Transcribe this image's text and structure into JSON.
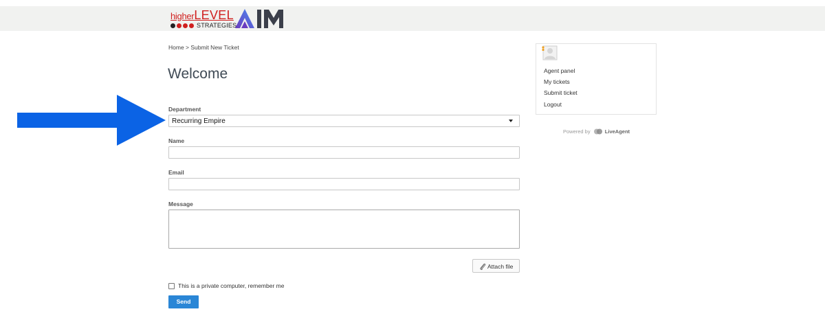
{
  "header": {
    "logo_higher": "higher",
    "logo_level": "LEVEL",
    "logo_strategies": "STRATEGIES",
    "logo_aim": "AIM",
    "dot_colors": [
      "#222222",
      "#d0201f",
      "#d0201f",
      "#d0201f"
    ]
  },
  "breadcrumb": "Home > Submit New Ticket",
  "page_title": "Welcome",
  "form": {
    "department_label": "Department",
    "department_value": "Recurring Empire",
    "name_label": "Name",
    "name_value": "",
    "email_label": "Email",
    "email_value": "",
    "message_label": "Message",
    "message_value": "",
    "attach_label": "Attach file",
    "remember_label": "This is a private computer, remember me",
    "remember_checked": false,
    "send_label": "Send"
  },
  "sidebar": {
    "links": [
      "Agent panel",
      "My tickets",
      "Submit ticket",
      "Logout"
    ],
    "powered_by": "Powered by",
    "powered_brand": "LiveAgent"
  },
  "annotation": {
    "arrow_color": "#0b63e5"
  },
  "colors": {
    "accent": "#2a86d6",
    "header_bg": "#f1f2f0",
    "title": "#3f4a55"
  },
  "icons": [
    "arrow-right-icon",
    "caret-down-icon",
    "paperclip-icon",
    "avatar-icon",
    "liveagent-logo-icon"
  ]
}
